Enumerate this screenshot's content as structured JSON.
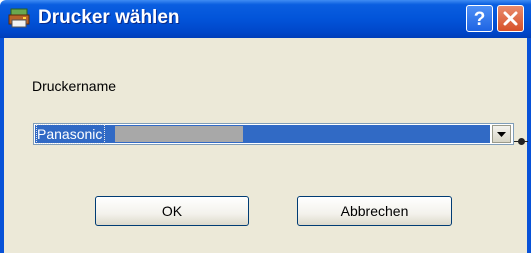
{
  "window": {
    "title": "Drucker wählen",
    "help_label": "?",
    "accent_color": "#0254d9",
    "close_color": "#d65129"
  },
  "form": {
    "printer_label": "Druckername",
    "printer_value": "Panasonic",
    "selection_color": "#316ac5"
  },
  "buttons": {
    "ok_label": "OK",
    "cancel_label": "Abbrechen"
  },
  "icons": {
    "app": "printer-icon",
    "help": "help-icon",
    "close": "close-icon",
    "dropdown": "chevron-down-icon"
  }
}
